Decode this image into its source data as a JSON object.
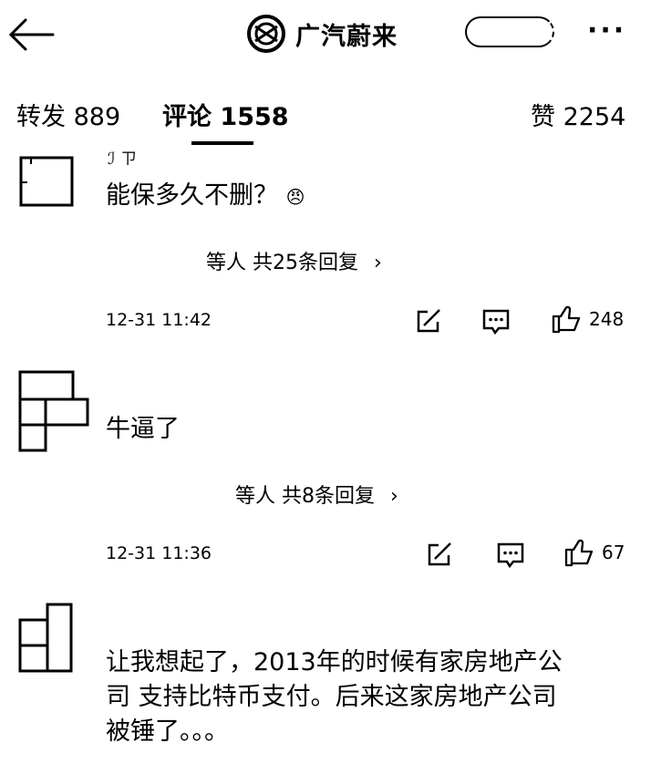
{
  "header": {
    "back_icon": "arrow-left-icon",
    "brand_icon": "gac-aion-logo-icon",
    "title": "广汽蔚来",
    "more_icon": "more-dots-icon"
  },
  "tabs": {
    "forward": {
      "label": "转发",
      "count": "889"
    },
    "comments": {
      "label": "评论",
      "count": "1558"
    },
    "likes": {
      "label": "赞",
      "count": "2254"
    }
  },
  "comments": [
    {
      "username": "ℐ     ㄗ",
      "text": "能保多久不删？",
      "emoji": "😠",
      "replies_text": "等人  共25条回复",
      "time": "12-31 11:42",
      "likes": "248"
    },
    {
      "username": "",
      "text": "牛逼了",
      "replies_text": "等人  共8条回复",
      "time": "12-31 11:36",
      "likes": "67"
    },
    {
      "username": "",
      "text_lines": [
        "让我想起了，2013年的时候有家房地产公",
        "司 支持比特币支付。后来这家房地产公司",
        "被锤了。。。"
      ]
    }
  ],
  "icons": {
    "repost": "edit-repost-icon",
    "comment": "comment-bubble-icon",
    "like": "thumbs-up-icon",
    "chevron": "chevron-right-icon"
  }
}
